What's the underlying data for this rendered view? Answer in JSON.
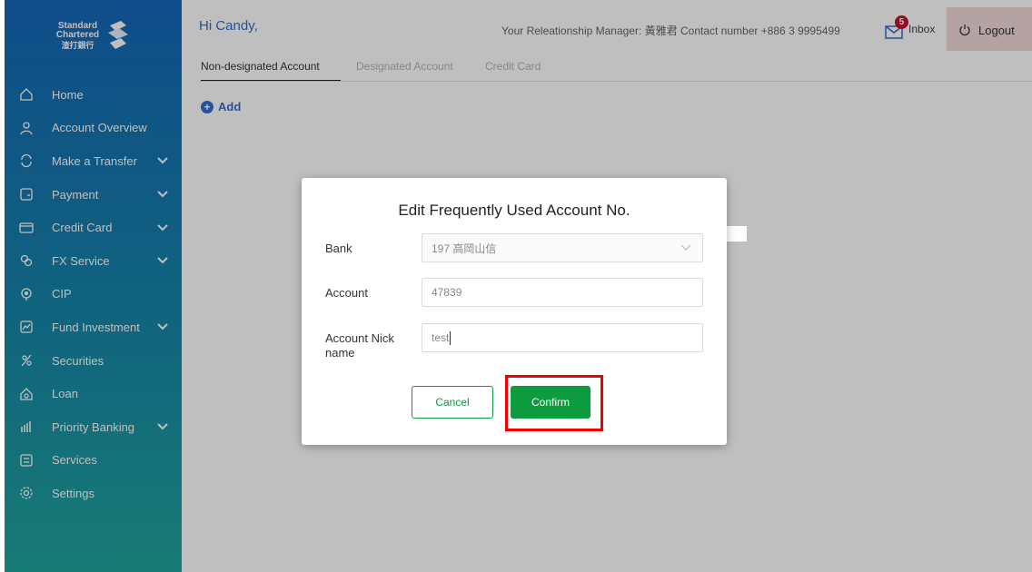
{
  "brand": {
    "line1": "Standard",
    "line2": "Chartered",
    "line3": "渣打銀行"
  },
  "sidebar": {
    "items": [
      {
        "label": "Home",
        "icon": "home-icon",
        "chevron": false
      },
      {
        "label": "Account Overview",
        "icon": "user-icon",
        "chevron": false
      },
      {
        "label": "Make a Transfer",
        "icon": "transfer-icon",
        "chevron": true
      },
      {
        "label": "Payment",
        "icon": "payment-icon",
        "chevron": true
      },
      {
        "label": "Credit Card",
        "icon": "credit-card-icon",
        "chevron": true
      },
      {
        "label": "FX Service",
        "icon": "fx-icon",
        "chevron": true
      },
      {
        "label": "CIP",
        "icon": "cip-icon",
        "chevron": false
      },
      {
        "label": "Fund Investment",
        "icon": "fund-icon",
        "chevron": true
      },
      {
        "label": "Securities",
        "icon": "securities-icon",
        "chevron": false
      },
      {
        "label": "Loan",
        "icon": "loan-icon",
        "chevron": false
      },
      {
        "label": "Priority Banking",
        "icon": "priority-banking-icon",
        "chevron": true
      },
      {
        "label": "Services",
        "icon": "services-icon",
        "chevron": false
      },
      {
        "label": "Settings",
        "icon": "settings-icon",
        "chevron": false
      }
    ]
  },
  "header": {
    "greeting": "Hi Candy,",
    "relationship_manager": "Your Releationship Manager: 黃雅君 Contact number +886 3 9995499",
    "inbox_label": "Inbox",
    "inbox_count": "5",
    "logout_label": "Logout"
  },
  "tabs": [
    {
      "label": "Non-designated Account",
      "active": true
    },
    {
      "label": "Designated Account",
      "active": false
    },
    {
      "label": "Credit Card",
      "active": false
    }
  ],
  "add_label": "Add",
  "modal": {
    "title": "Edit Frequently Used Account No.",
    "bank_label": "Bank",
    "bank_value": "197 高岡山信",
    "account_label": "Account",
    "account_value": "47839",
    "nickname_label": "Account Nick name",
    "nickname_value": "test",
    "cancel_label": "Cancel",
    "confirm_label": "Confirm"
  },
  "colors": {
    "sidebar_top": "#1567b8",
    "sidebar_bottom": "#20a59c",
    "link_blue": "#2f6fcf",
    "confirm_green": "#0c9c3f",
    "highlight_red": "#ee0000",
    "badge_red": "#c8102e"
  }
}
